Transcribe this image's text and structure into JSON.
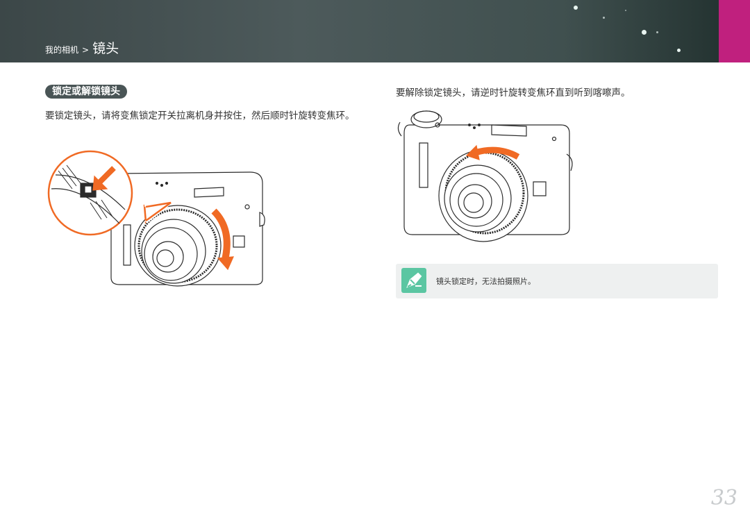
{
  "header": {
    "breadcrumb_parent": "我的相机",
    "breadcrumb_separator": ">",
    "breadcrumb_current": "镜头",
    "accent_color": "#c0207e",
    "background_color": "#4d5a5b"
  },
  "section": {
    "title": "锁定或解锁镜头",
    "left_instruction": "要锁定镜头，请将变焦锁定开关拉离机身并按住，然后顺时针旋转变焦环。",
    "right_instruction": "要解除锁定镜头，请逆时针旋转变焦环直到听到喀嚓声。"
  },
  "note": {
    "icon": "pencil-note-icon",
    "icon_color": "#5bc6a2",
    "text": "镜头锁定时，无法拍摄照片。"
  },
  "illustrations": {
    "arrow_color": "#f06a24"
  },
  "page_number": "33"
}
